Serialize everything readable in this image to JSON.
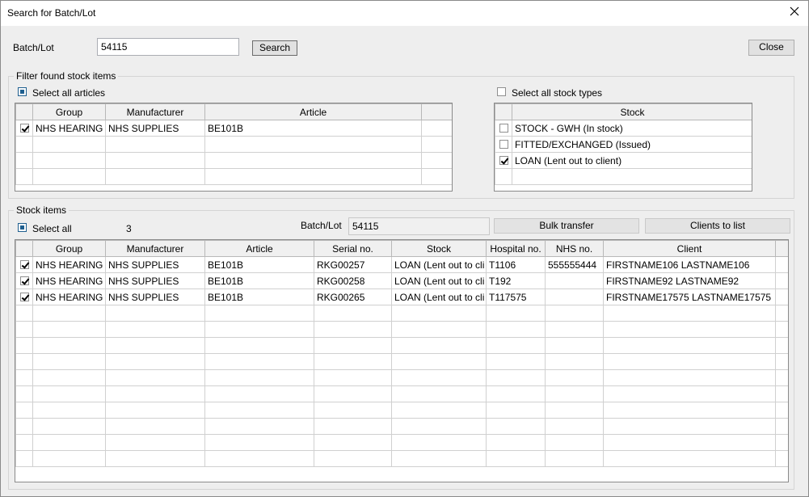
{
  "window": {
    "title": "Search for Batch/Lot"
  },
  "search": {
    "label": "Batch/Lot",
    "value": "54115",
    "button": "Search",
    "close": "Close"
  },
  "filter": {
    "legend": "Filter found stock items",
    "select_all_articles": "Select all articles",
    "select_all_stock_types": "Select all stock types",
    "articles_columns": [
      "Group",
      "Manufacturer",
      "Article"
    ],
    "articles_rows": [
      {
        "checked": true,
        "group": "NHS HEARING",
        "manufacturer": "NHS SUPPLIES",
        "article": "BE101B"
      }
    ],
    "stock_column": "Stock",
    "stock_rows": [
      {
        "checked": false,
        "stock": "STOCK - GWH (In stock)"
      },
      {
        "checked": false,
        "stock": "FITTED/EXCHANGED (Issued)"
      },
      {
        "checked": true,
        "stock": "LOAN (Lent out to client)"
      }
    ]
  },
  "stock_items": {
    "legend": "Stock items",
    "select_all": "Select all",
    "count": "3",
    "batch_label": "Batch/Lot",
    "batch_value": "54115",
    "bulk_transfer": "Bulk transfer",
    "clients_to_list": "Clients to list",
    "columns": [
      "Group",
      "Manufacturer",
      "Article",
      "Serial no.",
      "Stock",
      "Hospital no.",
      "NHS no.",
      "Client"
    ],
    "rows": [
      {
        "checked": true,
        "group": "NHS HEARING",
        "manufacturer": "NHS SUPPLIES",
        "article": "BE101B",
        "serial": "RKG00257",
        "stock": "LOAN (Lent out to cli",
        "hospital": "T1106",
        "nhs": "555555444",
        "client": "FIRSTNAME106 LASTNAME106"
      },
      {
        "checked": true,
        "group": "NHS HEARING",
        "manufacturer": "NHS SUPPLIES",
        "article": "BE101B",
        "serial": "RKG00258",
        "stock": "LOAN (Lent out to cli",
        "hospital": "T192",
        "nhs": "",
        "client": "FIRSTNAME92 LASTNAME92"
      },
      {
        "checked": true,
        "group": "NHS HEARING",
        "manufacturer": "NHS SUPPLIES",
        "article": "BE101B",
        "serial": "RKG00265",
        "stock": "LOAN (Lent out to cli",
        "hospital": "T117575",
        "nhs": "",
        "client": "FIRSTNAME17575 LASTNAME17575"
      }
    ]
  }
}
